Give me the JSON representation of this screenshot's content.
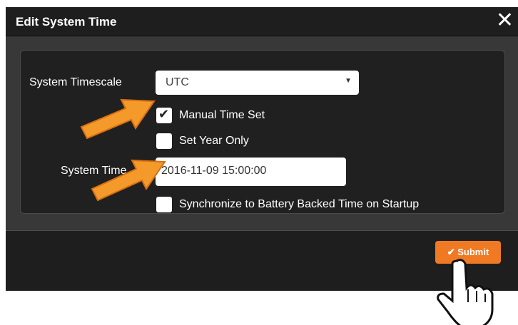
{
  "dialog": {
    "title": "Edit System Time",
    "close_glyph": "✕",
    "close_icon": "close-icon"
  },
  "form": {
    "timescale_label": "System Timescale",
    "timescale_value": "UTC",
    "manual_time_label": "Manual Time Set",
    "manual_time_checked": true,
    "year_only_label": "Set Year Only",
    "year_only_checked": false,
    "system_time_label": "System Time",
    "system_time_value": "2016-11-09 15:00:00",
    "sync_label": "Synchronize to Battery Backed Time on Startup",
    "sync_checked": false
  },
  "footer": {
    "submit_label": "Submit",
    "submit_icon": "check-icon"
  },
  "colors": {
    "accent": "#f07a24",
    "annotation_arrow": "#f39a2b"
  }
}
